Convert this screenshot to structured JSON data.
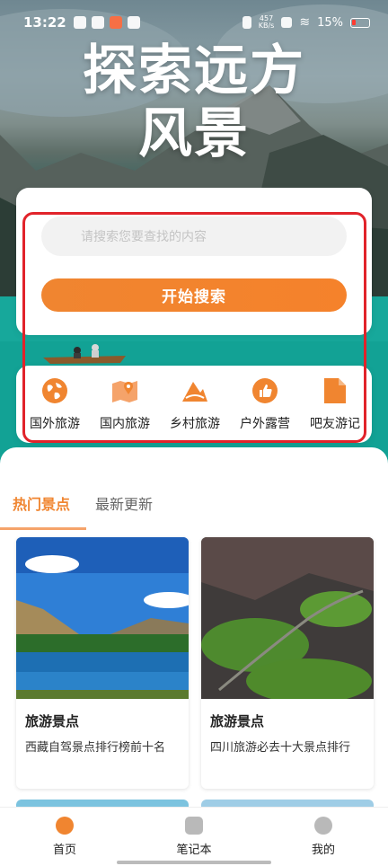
{
  "status_bar": {
    "time": "13:22",
    "net_speed": "457",
    "net_unit": "KB/s",
    "battery": "15%"
  },
  "hero": {
    "title_line1": "探索远方",
    "title_line2": "风景"
  },
  "search": {
    "placeholder": "请搜索您要查找的内容",
    "value": "",
    "button_label": "开始搜索"
  },
  "categories": [
    {
      "label": "国外旅游",
      "icon": "globe-icon"
    },
    {
      "label": "国内旅游",
      "icon": "map-pin-icon"
    },
    {
      "label": "乡村旅游",
      "icon": "mountain-icon"
    },
    {
      "label": "户外露营",
      "icon": "thumbs-up-icon"
    },
    {
      "label": "吧友游记",
      "icon": "document-icon"
    }
  ],
  "tabs": [
    {
      "label": "热门景点",
      "active": true
    },
    {
      "label": "最新更新",
      "active": false
    }
  ],
  "spots": [
    {
      "name": "旅游景点",
      "desc": "西藏自驾景点排行榜前十名"
    },
    {
      "name": "旅游景点",
      "desc": "四川旅游必去十大景点排行"
    }
  ],
  "bottom_nav": [
    {
      "label": "首页",
      "icon": "home-icon",
      "active": true
    },
    {
      "label": "笔记本",
      "icon": "notebook-icon",
      "active": false
    },
    {
      "label": "我的",
      "icon": "profile-icon",
      "active": false
    }
  ],
  "colors": {
    "accent": "#f08530",
    "annotation": "#e1232a",
    "lake": "#18b0a2"
  }
}
